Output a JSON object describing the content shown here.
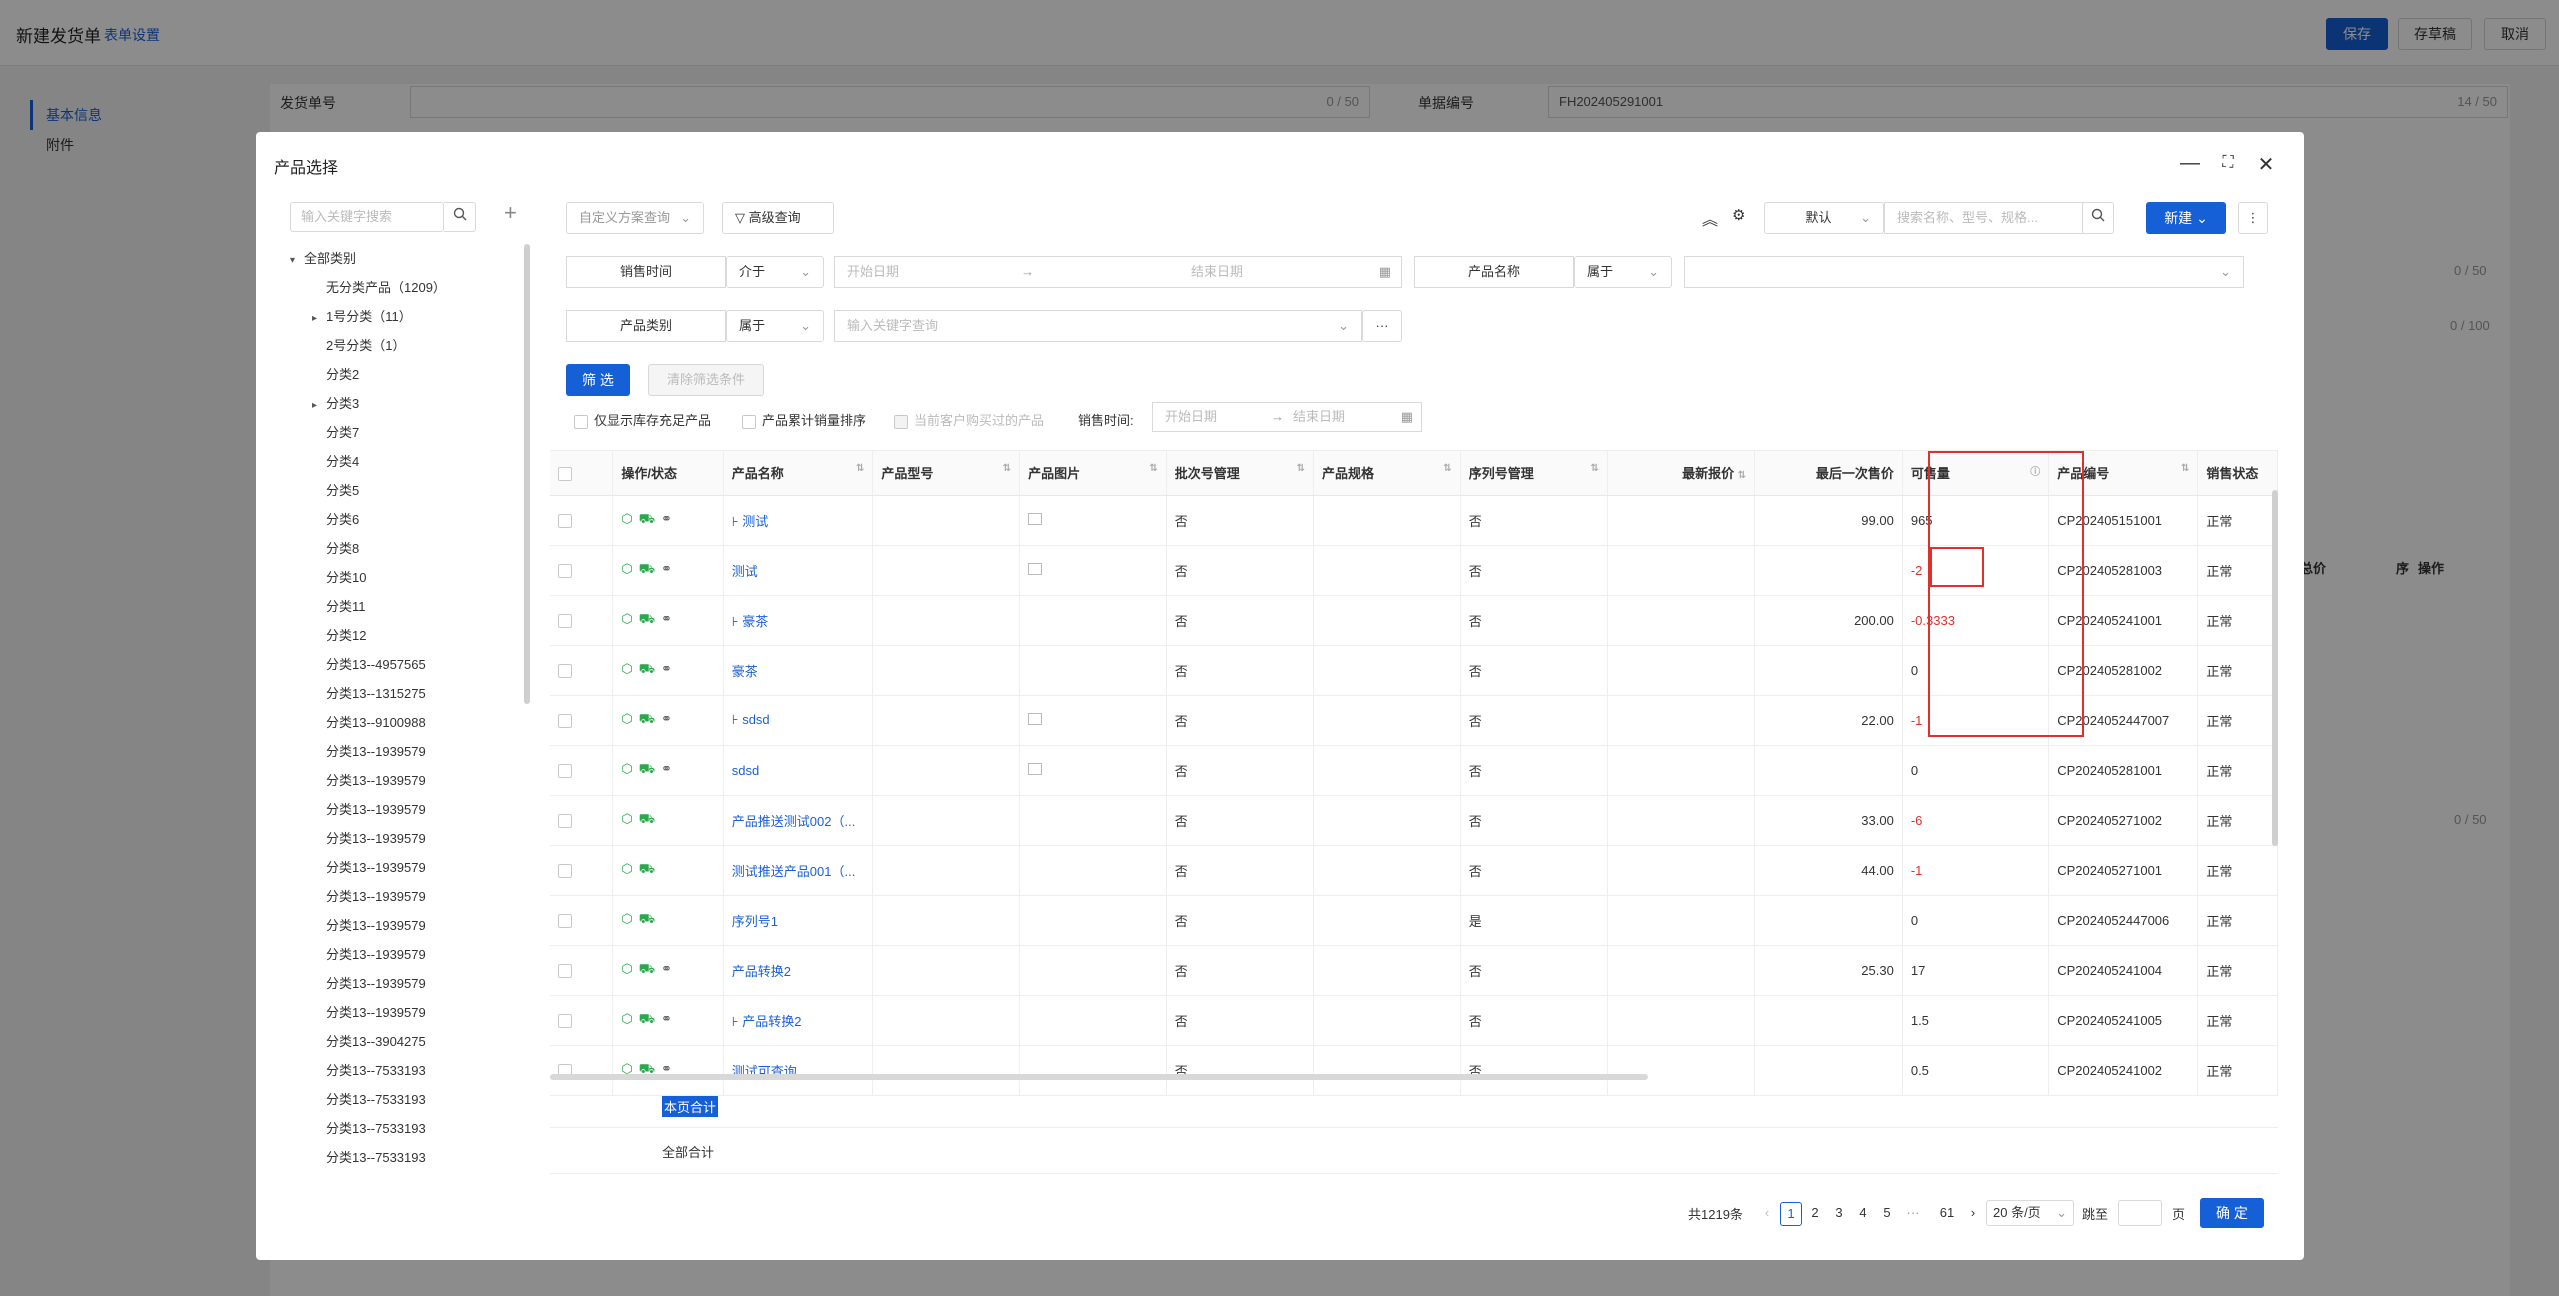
{
  "page": {
    "title": "新建发货单",
    "form_settings": "表单设置",
    "buttons": {
      "save": "保存",
      "draft": "存草稿",
      "cancel": "取消"
    },
    "nav": [
      "基本信息",
      "附件"
    ],
    "fields": {
      "ship_no_label": "发货单号",
      "ship_no_count": "0 / 50",
      "doc_no_label": "单据编号",
      "doc_no_value": "FH202405291001",
      "doc_no_count": "14 / 50",
      "count_a": "0 / 50",
      "count_b": "0 / 100",
      "count_c": "0 / 50"
    }
  },
  "modal": {
    "title": "产品选择",
    "tree": {
      "search_placeholder": "输入关键字搜索",
      "nodes": [
        {
          "label": "全部类别",
          "caret": "▾",
          "indent": 0
        },
        {
          "label": "无分类产品（1209）",
          "caret": "",
          "indent": 1
        },
        {
          "label": "1号分类（11）",
          "caret": "▸",
          "indent": 1
        },
        {
          "label": "2号分类（1）",
          "caret": "",
          "indent": 1
        },
        {
          "label": "分类2",
          "caret": "",
          "indent": 1
        },
        {
          "label": "分类3",
          "caret": "▸",
          "indent": 1
        },
        {
          "label": "分类7",
          "caret": "",
          "indent": 1
        },
        {
          "label": "分类4",
          "caret": "",
          "indent": 1
        },
        {
          "label": "分类5",
          "caret": "",
          "indent": 1
        },
        {
          "label": "分类6",
          "caret": "",
          "indent": 1
        },
        {
          "label": "分类8",
          "caret": "",
          "indent": 1
        },
        {
          "label": "分类10",
          "caret": "",
          "indent": 1
        },
        {
          "label": "分类11",
          "caret": "",
          "indent": 1
        },
        {
          "label": "分类12",
          "caret": "",
          "indent": 1
        },
        {
          "label": "分类13--4957565",
          "caret": "",
          "indent": 1
        },
        {
          "label": "分类13--1315275",
          "caret": "",
          "indent": 1
        },
        {
          "label": "分类13--9100988",
          "caret": "",
          "indent": 1
        },
        {
          "label": "分类13--1939579",
          "caret": "",
          "indent": 1
        },
        {
          "label": "分类13--1939579",
          "caret": "",
          "indent": 1
        },
        {
          "label": "分类13--1939579",
          "caret": "",
          "indent": 1
        },
        {
          "label": "分类13--1939579",
          "caret": "",
          "indent": 1
        },
        {
          "label": "分类13--1939579",
          "caret": "",
          "indent": 1
        },
        {
          "label": "分类13--1939579",
          "caret": "",
          "indent": 1
        },
        {
          "label": "分类13--1939579",
          "caret": "",
          "indent": 1
        },
        {
          "label": "分类13--1939579",
          "caret": "",
          "indent": 1
        },
        {
          "label": "分类13--1939579",
          "caret": "",
          "indent": 1
        },
        {
          "label": "分类13--1939579",
          "caret": "",
          "indent": 1
        },
        {
          "label": "分类13--3904275",
          "caret": "",
          "indent": 1
        },
        {
          "label": "分类13--7533193",
          "caret": "",
          "indent": 1
        },
        {
          "label": "分类13--7533193",
          "caret": "",
          "indent": 1
        },
        {
          "label": "分类13--7533193",
          "caret": "",
          "indent": 1
        },
        {
          "label": "分类13--7533193",
          "caret": "",
          "indent": 1
        }
      ]
    },
    "toolbar": {
      "custom_query": "自定义方案查询",
      "advanced_query": "高级查询",
      "scheme": "默认",
      "search_placeholder": "搜索名称、型号、规格...",
      "new_btn": "新建"
    },
    "filters": {
      "sale_time_label": "销售时间",
      "between": "介于",
      "start_date": "开始日期",
      "end_date": "结束日期",
      "arrow": "→",
      "product_name_label": "产品名称",
      "belongs": "属于",
      "category_label": "产品类别",
      "category_belongs": "属于",
      "keyword_placeholder": "输入关键字查询",
      "filter_btn": "筛 选",
      "clear_btn": "清除筛选条件",
      "opt_stock": "仅显示库存充足产品",
      "opt_sort": "产品累计销量排序",
      "opt_bought": "当前客户购买过的产品",
      "sale_time2": "销售时间:",
      "start_date2": "开始日期",
      "end_date2": "结束日期"
    },
    "table": {
      "headers": [
        "操作/状态",
        "产品名称",
        "产品型号",
        "产品图片",
        "批次号管理",
        "产品规格",
        "序列号管理",
        "最新报价",
        "最后一次售价",
        "可售量",
        "产品编号",
        "销售状态"
      ],
      "rows": [
        {
          "name": "测试",
          "child": true,
          "img": true,
          "batch": "否",
          "serial": "否",
          "last_price": "99.00",
          "qty": "965",
          "qty_neg": false,
          "code": "CP202405151001",
          "status": "正常",
          "icons": 3
        },
        {
          "name": "测试",
          "child": false,
          "img": true,
          "batch": "否",
          "serial": "否",
          "last_price": "",
          "qty": "-2",
          "qty_neg": true,
          "code": "CP202405281003",
          "status": "正常",
          "icons": 3
        },
        {
          "name": "豪茶",
          "child": true,
          "img": false,
          "batch": "否",
          "serial": "否",
          "last_price": "200.00",
          "qty": "-0.3333",
          "qty_neg": true,
          "code": "CP202405241001",
          "status": "正常",
          "icons": 3
        },
        {
          "name": "豪茶",
          "child": false,
          "img": false,
          "batch": "否",
          "serial": "否",
          "last_price": "",
          "qty": "0",
          "qty_neg": false,
          "code": "CP202405281002",
          "status": "正常",
          "icons": 3
        },
        {
          "name": "sdsd",
          "child": true,
          "img": true,
          "batch": "否",
          "serial": "否",
          "last_price": "22.00",
          "qty": "-1",
          "qty_neg": true,
          "code": "CP2024052447007",
          "status": "正常",
          "icons": 3
        },
        {
          "name": "sdsd",
          "child": false,
          "img": true,
          "batch": "否",
          "serial": "否",
          "last_price": "",
          "qty": "0",
          "qty_neg": false,
          "code": "CP202405281001",
          "status": "正常",
          "icons": 3
        },
        {
          "name": "产品推送测试002（...",
          "child": false,
          "img": false,
          "batch": "否",
          "serial": "否",
          "last_price": "33.00",
          "qty": "-6",
          "qty_neg": true,
          "code": "CP202405271002",
          "status": "正常",
          "icons": 2
        },
        {
          "name": "测试推送产品001（...",
          "child": false,
          "img": false,
          "batch": "否",
          "serial": "否",
          "last_price": "44.00",
          "qty": "-1",
          "qty_neg": true,
          "code": "CP202405271001",
          "status": "正常",
          "icons": 2
        },
        {
          "name": "序列号1",
          "child": false,
          "img": false,
          "batch": "否",
          "serial": "是",
          "last_price": "",
          "qty": "0",
          "qty_neg": false,
          "code": "CP2024052447006",
          "status": "正常",
          "icons": 2
        },
        {
          "name": "产品转换2",
          "child": false,
          "img": false,
          "batch": "否",
          "serial": "否",
          "last_price": "25.30",
          "qty": "17",
          "qty_neg": false,
          "code": "CP202405241004",
          "status": "正常",
          "icons": 3
        },
        {
          "name": "产品转换2",
          "child": true,
          "img": false,
          "batch": "否",
          "serial": "否",
          "last_price": "",
          "qty": "1.5",
          "qty_neg": false,
          "code": "CP202405241005",
          "status": "正常",
          "icons": 3
        },
        {
          "name": "测试可查询",
          "child": false,
          "img": false,
          "batch": "否",
          "serial": "否",
          "last_price": "",
          "qty": "0.5",
          "qty_neg": false,
          "code": "CP202405241002",
          "status": "正常",
          "icons": 3
        }
      ],
      "page_total": "本页合计",
      "all_total": "全部合计"
    },
    "pagination": {
      "total": "共1219条",
      "pages": [
        "1",
        "2",
        "3",
        "4",
        "5",
        "···",
        "61"
      ],
      "page_size": "20 条/页",
      "jump": "跳至",
      "page_unit": "页",
      "confirm": "确 定"
    }
  },
  "bg_right": {
    "total_price": "总价",
    "seq": "序",
    "op": "操作"
  },
  "colors": {
    "primary": "#1560d6",
    "negative": "#e0302b",
    "green_icon": "#2aa84a"
  }
}
